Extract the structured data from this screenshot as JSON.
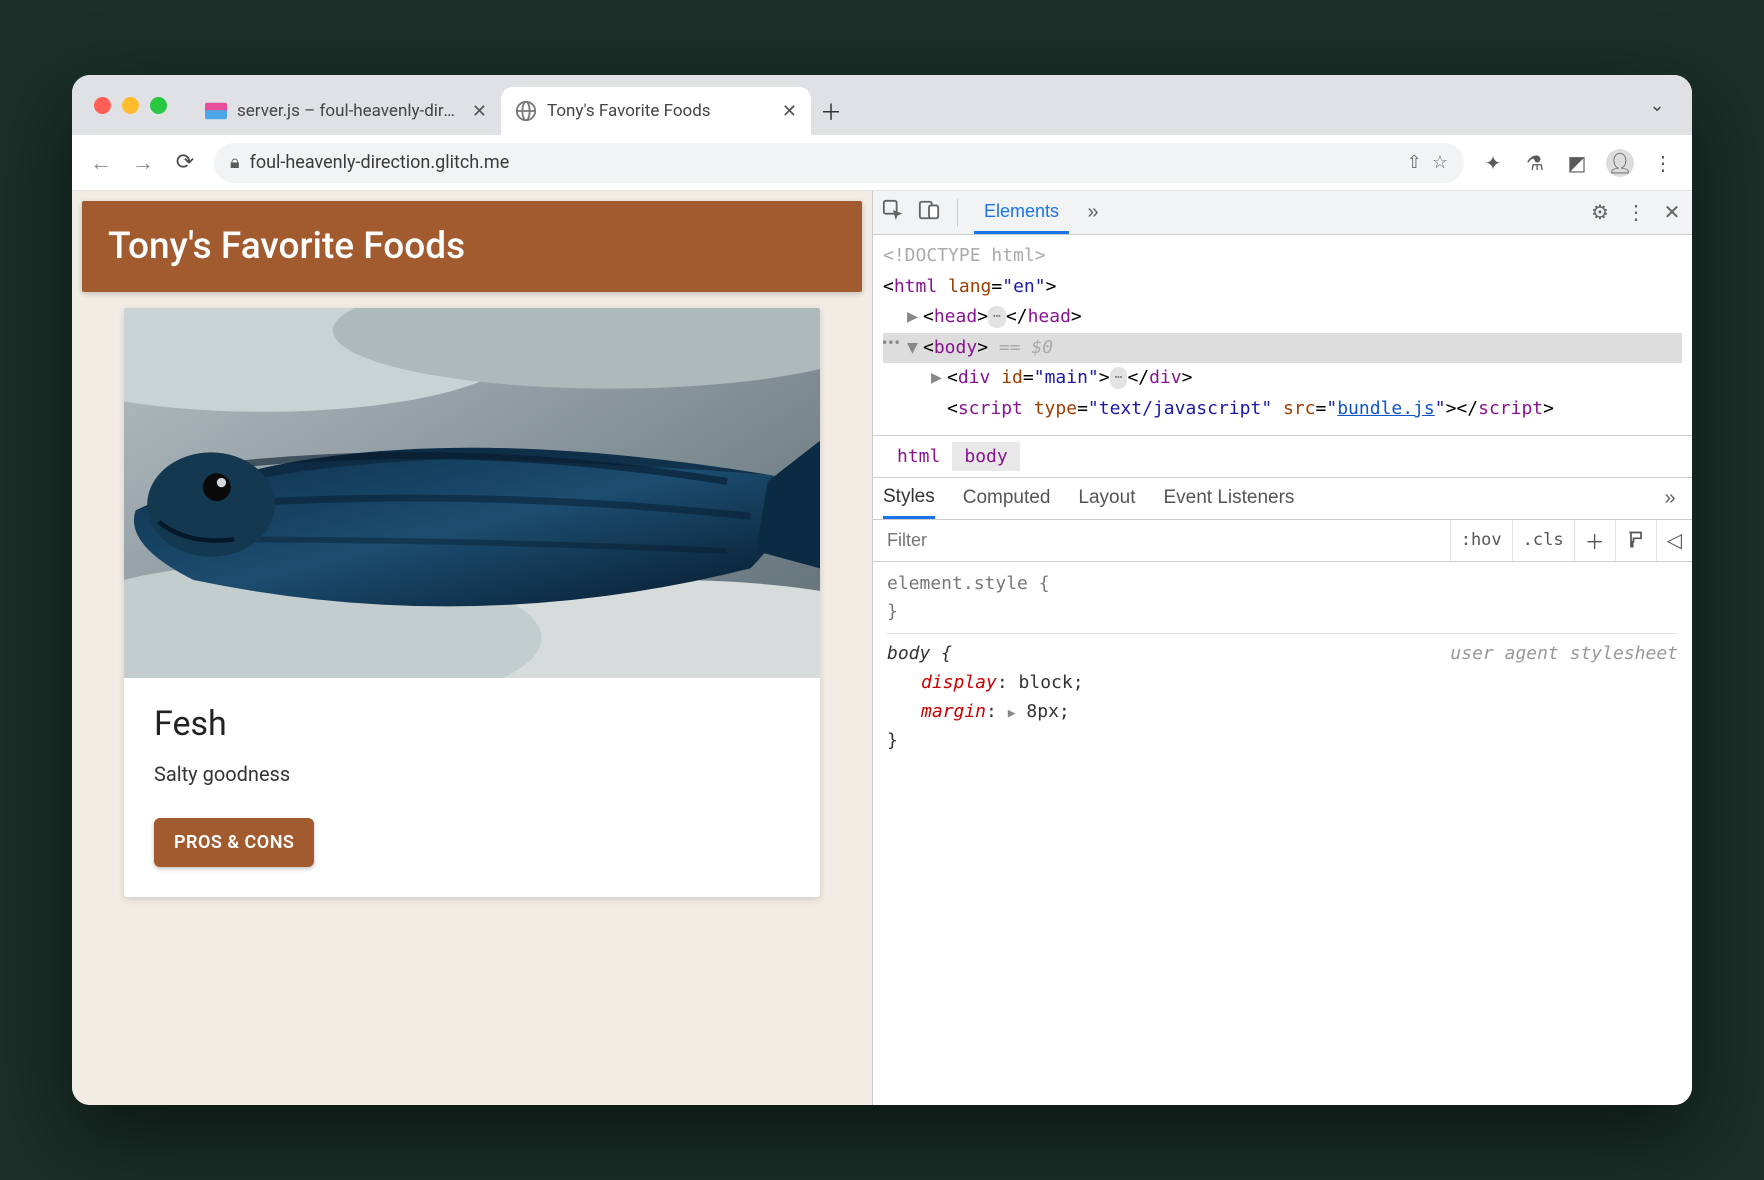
{
  "tabs": [
    {
      "title": "server.js – foul-heavenly-direct"
    },
    {
      "title": "Tony's Favorite Foods"
    }
  ],
  "addr": {
    "url": "foul-heavenly-direction.glitch.me"
  },
  "page": {
    "header": "Tony's Favorite Foods",
    "card": {
      "title": "Fesh",
      "subtitle": "Salty goodness",
      "button": "PROS & CONS"
    }
  },
  "devtools": {
    "panel": "Elements",
    "dom": {
      "doctype": "<!DOCTYPE html>",
      "html_open": "html",
      "html_lang_attr": "lang",
      "html_lang_val": "\"en\"",
      "head": "head",
      "body": "body",
      "eq": "== $0",
      "div": "div",
      "div_id_attr": "id",
      "div_id_val": "\"main\"",
      "script": "script",
      "script_type_attr": "type",
      "script_type_val": "\"text/javascript\"",
      "script_src_attr": "src",
      "script_src_val_pre": "\"",
      "script_src_link": "bundle.js",
      "script_src_val_post": "\""
    },
    "breadcrumb": [
      "html",
      "body"
    ],
    "styles_tabs": [
      "Styles",
      "Computed",
      "Layout",
      "Event Listeners"
    ],
    "filter_placeholder": "Filter",
    "hov": ":hov",
    "cls": ".cls",
    "element_style": "element.style {",
    "body_rule": {
      "selector": "body {",
      "source": "user agent stylesheet",
      "props": [
        {
          "name": "display",
          "value": "block;"
        },
        {
          "name": "margin",
          "value": "8px;",
          "expandable": true
        }
      ],
      "close": "}"
    }
  }
}
